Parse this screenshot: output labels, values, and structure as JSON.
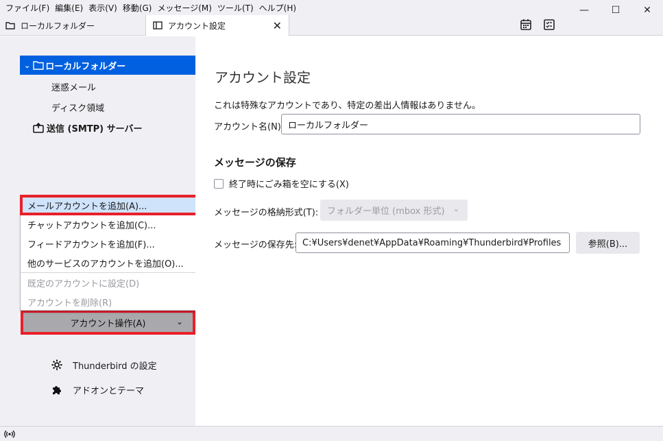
{
  "menubar": {
    "items": [
      "ファイル(F)",
      "編集(E)",
      "表示(V)",
      "移動(G)",
      "メッセージ(M)",
      "ツール(T)",
      "ヘルプ(H)"
    ]
  },
  "window_controls": {
    "minimize": "—",
    "maximize": "☐",
    "close": "✕"
  },
  "tabs": [
    {
      "label": "ローカルフォルダー",
      "icon": "folder-icon"
    },
    {
      "label": "アカウント設定",
      "icon": "settings-tab-icon",
      "close": "✕"
    }
  ],
  "toolbar_icons": [
    "calendar-icon",
    "tasks-icon"
  ],
  "sidebar": {
    "account": {
      "chevron": "⌄",
      "label": "ローカルフォルダー"
    },
    "sub_items": [
      "迷惑メール",
      "ディスク領域"
    ],
    "smtp_label": "送信 (SMTP) サーバー",
    "popup_items": [
      {
        "label": "メールアカウントを追加(A)...",
        "enabled": true,
        "highlighted": true
      },
      {
        "label": "チャットアカウントを追加(C)...",
        "enabled": true
      },
      {
        "label": "フィードアカウントを追加(F)...",
        "enabled": true
      },
      {
        "label": "他のサービスのアカウントを追加(O)...",
        "enabled": true
      },
      {
        "label": "既定のアカウントに設定(D)",
        "enabled": false
      },
      {
        "label": "アカウントを削除(R)",
        "enabled": false
      }
    ],
    "account_actions": {
      "label": "アカウント操作(A)",
      "caret": "⌄"
    },
    "bottom": [
      {
        "label": "Thunderbird の設定",
        "icon": "gear-icon"
      },
      {
        "label": "アドオンとテーマ",
        "icon": "puzzle-icon"
      }
    ]
  },
  "main": {
    "title": "アカウント設定",
    "description": "これは特殊なアカウントであり、特定の差出人情報はありません。",
    "account_name_label": "アカウント名(N):",
    "account_name_value": "ローカルフォルダー",
    "storage_heading": "メッセージの保存",
    "empty_trash_label": "終了時にごみ箱を空にする(X)",
    "empty_trash_checked": false,
    "store_type_label": "メッセージの格納形式(T):",
    "store_type_value": "フォルダー単位 (mbox 形式)",
    "store_path_label": "メッセージの保存先:",
    "store_path_value": "C:¥Users¥denet¥AppData¥Roaming¥Thunderbird¥Profiles",
    "browse_label": "参照(B)..."
  },
  "colors": {
    "selected": "#0060df",
    "highlight_border": "#e8202a",
    "sidebar_bg": "#f0f0f4"
  }
}
